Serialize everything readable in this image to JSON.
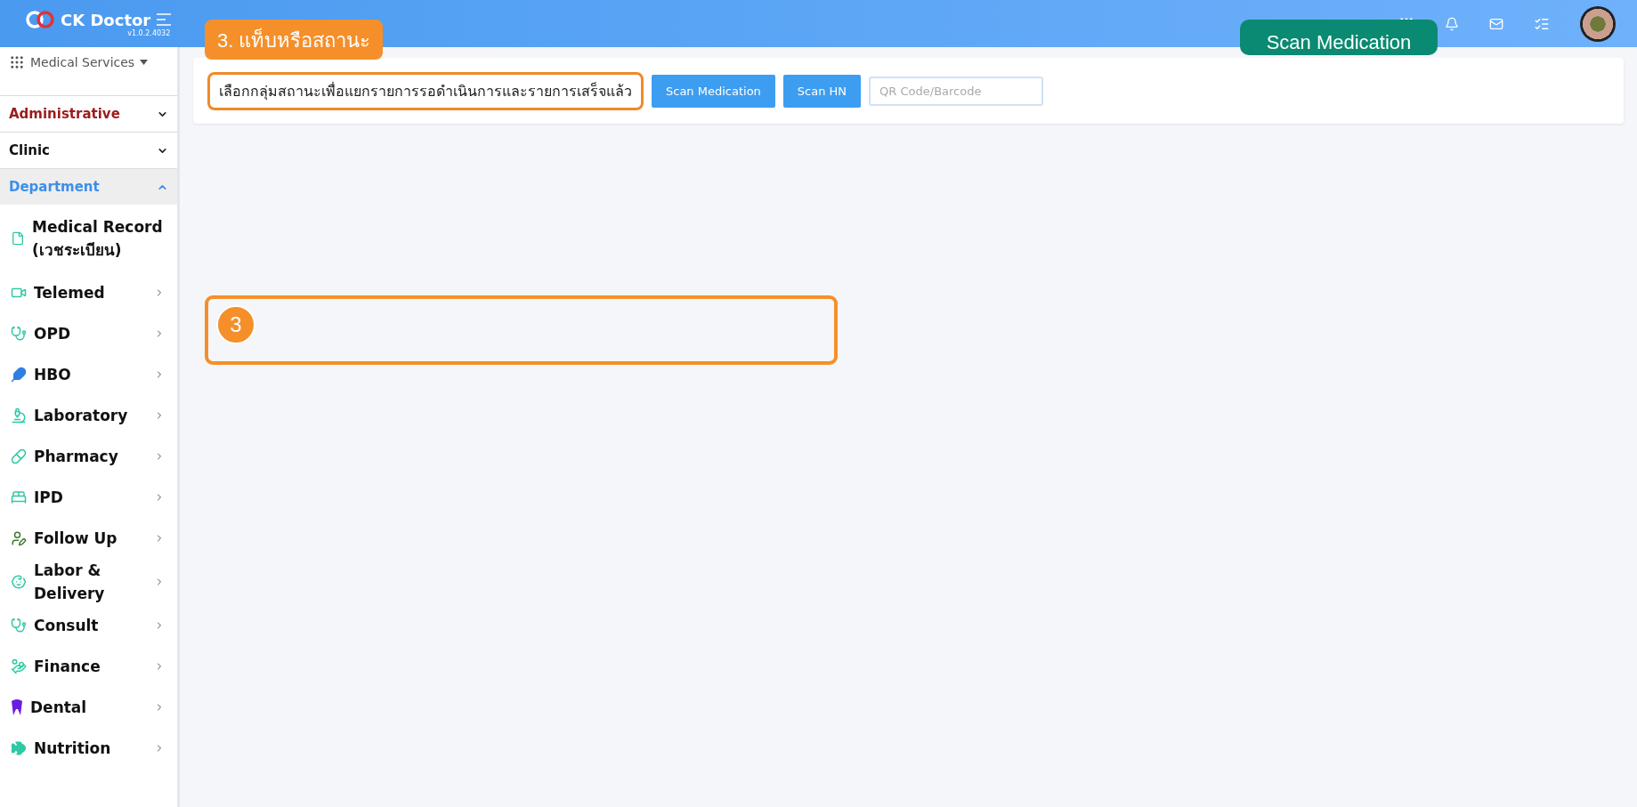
{
  "header": {
    "brand": "CK Doctor",
    "version": "v1.0.2.4032"
  },
  "sidebar": {
    "service_menu": "Medical Services",
    "sections": [
      {
        "label": "Administrative",
        "color": "#9b1c1c",
        "expanded": false
      },
      {
        "label": "Clinic",
        "color": "#111111",
        "expanded": false
      },
      {
        "label": "Department",
        "color": "#3b8fe8",
        "expanded": true
      }
    ],
    "items": [
      {
        "label": "Medical Record (เวชระเบียน)",
        "has_submenu": false
      },
      {
        "label": "Telemed",
        "has_submenu": true
      },
      {
        "label": "OPD",
        "has_submenu": true
      },
      {
        "label": "HBO",
        "has_submenu": true
      },
      {
        "label": "Laboratory",
        "has_submenu": true
      },
      {
        "label": "Pharmacy",
        "has_submenu": true
      },
      {
        "label": "IPD",
        "has_submenu": true
      },
      {
        "label": "Follow Up",
        "has_submenu": true
      },
      {
        "label": "Labor & Delivery",
        "has_submenu": true
      },
      {
        "label": "Consult",
        "has_submenu": true
      },
      {
        "label": "Finance",
        "has_submenu": true
      },
      {
        "label": "Dental",
        "has_submenu": true
      },
      {
        "label": "Nutrition",
        "has_submenu": true
      }
    ]
  },
  "toolbar": {
    "status_filter": "เลือกกลุ่มสถานะเพื่อแยกรายการรอดำเนินการและรายการเสร็จแล้ว",
    "buttons": [
      "Scan Medication",
      "Scan HN"
    ],
    "search": {
      "placeholder": "QR Code/Barcode"
    }
  },
  "annotations": {
    "callout": "3. แท็บหรือสถานะ",
    "tooltip": "Scan Medication",
    "step_marker": "3"
  }
}
